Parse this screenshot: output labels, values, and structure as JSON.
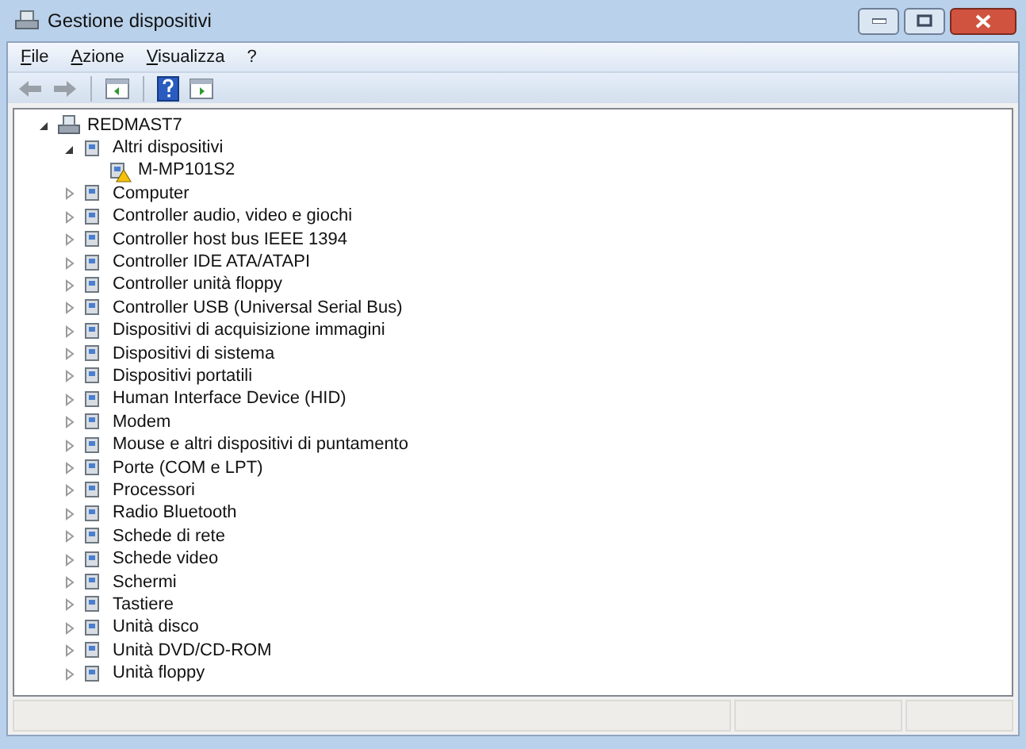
{
  "window": {
    "title": "Gestione dispositivi"
  },
  "menu": [
    {
      "label": "File"
    },
    {
      "label": "Azione"
    },
    {
      "label": "Visualizza"
    },
    {
      "label": "?"
    }
  ],
  "toolbar": [
    {
      "kind": "back",
      "disabled": true
    },
    {
      "kind": "forward",
      "disabled": true
    },
    {
      "kind": "separator"
    },
    {
      "kind": "panel"
    },
    {
      "kind": "separator"
    },
    {
      "kind": "help"
    },
    {
      "kind": "panel2"
    }
  ],
  "tree": [
    {
      "label": "REDMAST7",
      "expanded": true,
      "warning": false,
      "children": [
        {
          "label": "Altri dispositivi",
          "expanded": true,
          "warning": false,
          "children": [
            {
              "label": "M-MP101S2",
              "warning": true
            }
          ]
        },
        {
          "label": "Computer",
          "expanded": false,
          "warning": false
        },
        {
          "label": "Controller audio, video e giochi",
          "expanded": false,
          "warning": false
        },
        {
          "label": "Controller host bus IEEE 1394",
          "expanded": false,
          "warning": false
        },
        {
          "label": "Controller IDE ATA/ATAPI",
          "expanded": false,
          "warning": false
        },
        {
          "label": "Controller unità floppy",
          "expanded": false,
          "warning": false
        },
        {
          "label": "Controller USB (Universal Serial Bus)",
          "expanded": false,
          "warning": false
        },
        {
          "label": "Dispositivi di acquisizione immagini",
          "expanded": false,
          "warning": false
        },
        {
          "label": "Dispositivi di sistema",
          "expanded": false,
          "warning": false
        },
        {
          "label": "Dispositivi portatili",
          "expanded": false,
          "warning": false
        },
        {
          "label": "Human Interface Device (HID)",
          "expanded": false,
          "warning": false
        },
        {
          "label": "Modem",
          "expanded": false,
          "warning": false
        },
        {
          "label": "Mouse e altri dispositivi di puntamento",
          "expanded": false,
          "warning": false
        },
        {
          "label": "Porte (COM e LPT)",
          "expanded": false,
          "warning": false
        },
        {
          "label": "Processori",
          "expanded": false,
          "warning": false
        },
        {
          "label": "Radio Bluetooth",
          "expanded": false,
          "warning": false
        },
        {
          "label": "Schede di rete",
          "expanded": false,
          "warning": false
        },
        {
          "label": "Schede video",
          "expanded": false,
          "warning": false
        },
        {
          "label": "Schermi",
          "expanded": false,
          "warning": false
        },
        {
          "label": "Tastiere",
          "expanded": false,
          "warning": false
        },
        {
          "label": "Unità disco",
          "expanded": false,
          "warning": false
        },
        {
          "label": "Unità DVD/CD-ROM",
          "expanded": false,
          "warning": false
        },
        {
          "label": "Unità floppy",
          "expanded": false,
          "warning": false
        }
      ]
    }
  ]
}
